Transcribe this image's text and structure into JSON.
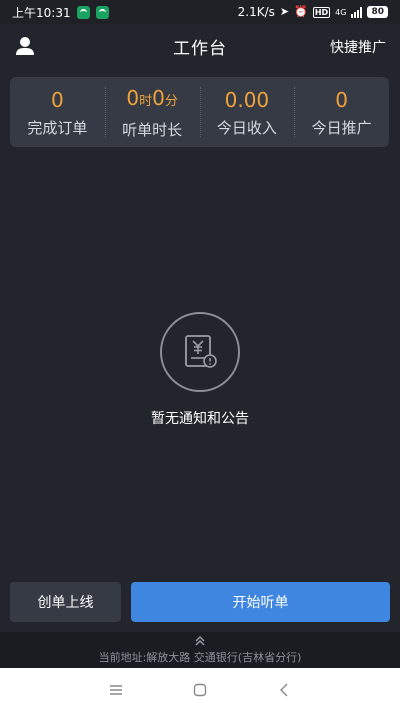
{
  "status_bar": {
    "time": "上午10:31",
    "network_speed": "2.1K/s",
    "hd": "HD",
    "network_type": "4G",
    "battery": "80"
  },
  "header": {
    "title": "工作台",
    "quick_promote": "快捷推广"
  },
  "stats": {
    "completed_orders": {
      "value": "0",
      "label": "完成订单"
    },
    "listen_duration": {
      "hours": "0",
      "hours_unit": "时",
      "minutes": "0",
      "minutes_unit": "分",
      "label": "听单时长"
    },
    "today_income": {
      "value": "0.00",
      "label": "今日收入"
    },
    "today_promote": {
      "value": "0",
      "label": "今日推广"
    }
  },
  "empty_state": {
    "message": "暂无通知和公告"
  },
  "actions": {
    "create_order_online": "创单上线",
    "start_listening": "开始听单"
  },
  "address": {
    "text": "当前地址:解放大路 交通银行(吉林省分行)"
  },
  "colors": {
    "background": "#23252c",
    "card": "#353a45",
    "accent_orange": "#f0a23a",
    "primary_blue": "#3e86e0"
  },
  "icons": {
    "user": "user-icon",
    "empty": "receipt-yuan-icon",
    "expand": "chevron-up-icon"
  }
}
